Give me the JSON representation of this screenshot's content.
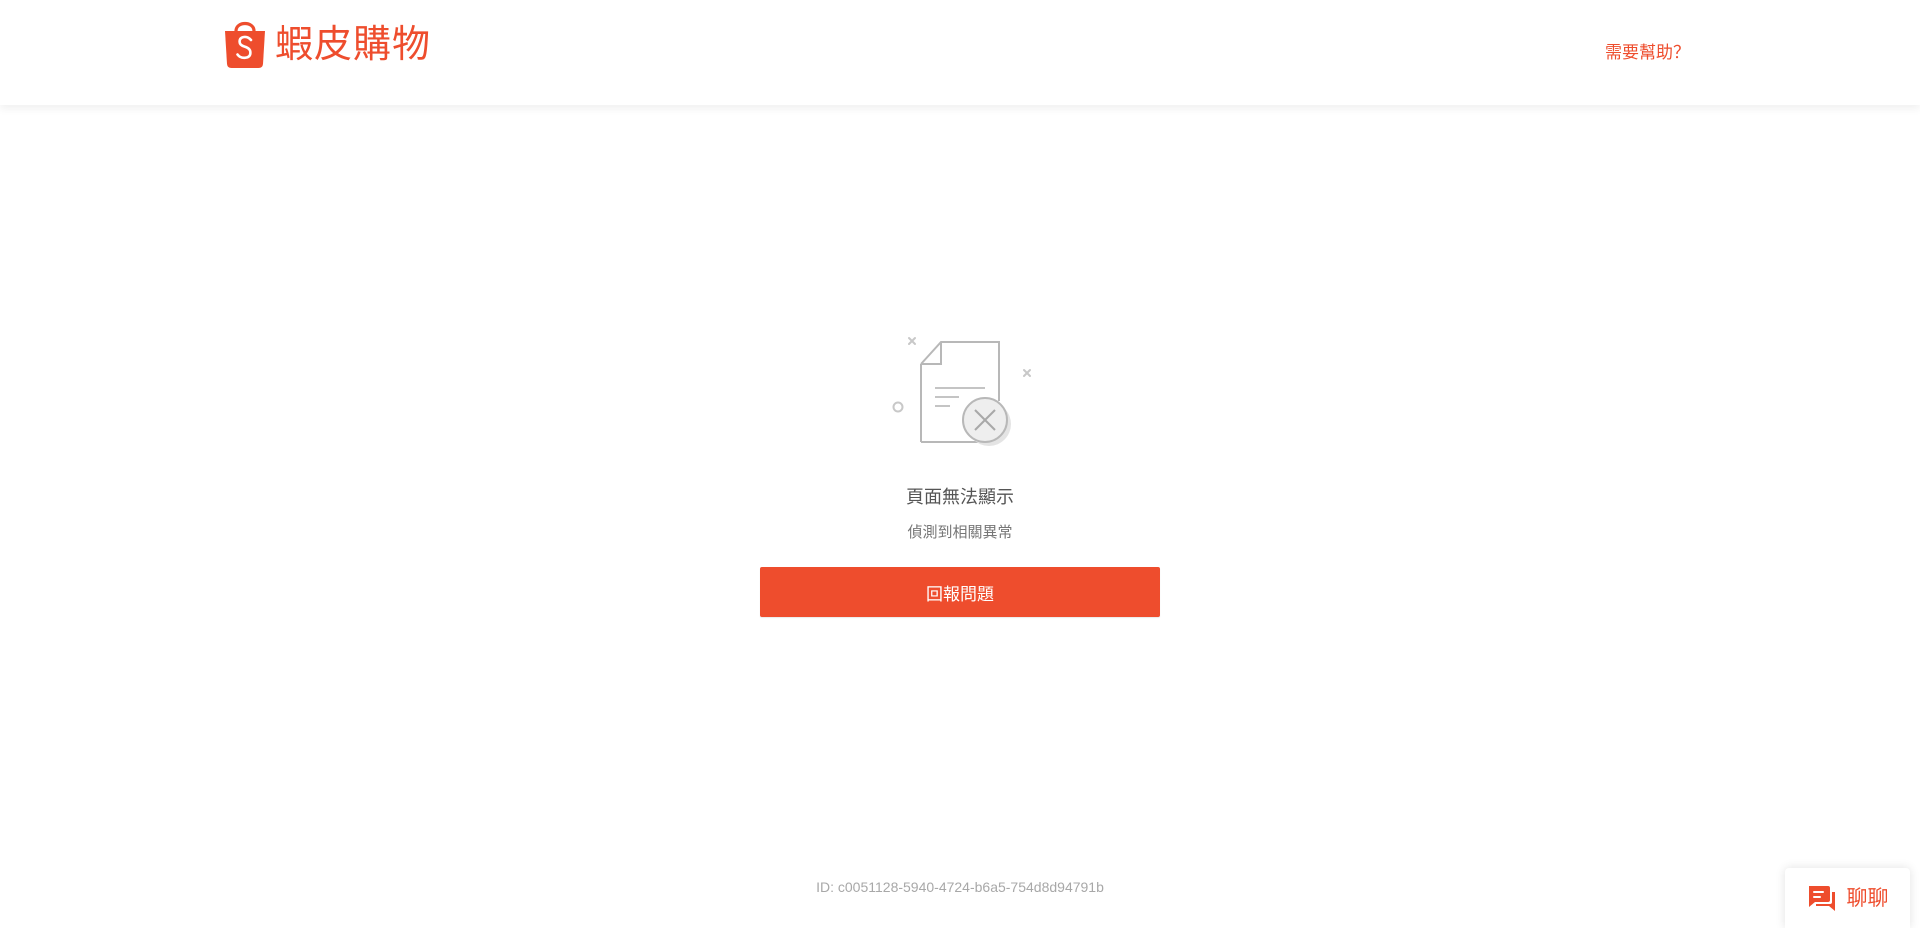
{
  "header": {
    "brand_name": "蝦皮購物",
    "help_link_label": "需要幫助？"
  },
  "error": {
    "title": "頁面無法顯示",
    "subtitle": "偵測到相關異常",
    "report_button_label": "回報問題",
    "id_text": "ID: c0051128-5940-4724-b6a5-754d8d94791b"
  },
  "chat_widget": {
    "label": "聊聊"
  },
  "icons": {
    "logo": "shopee-bag-icon",
    "illustration": "document-error-icon",
    "chat": "chat-bubble-icon"
  },
  "colors": {
    "brand": "#ee4d2d",
    "text_dark": "#555555",
    "text_muted": "#777777",
    "id_text": "#a8a8a8"
  }
}
